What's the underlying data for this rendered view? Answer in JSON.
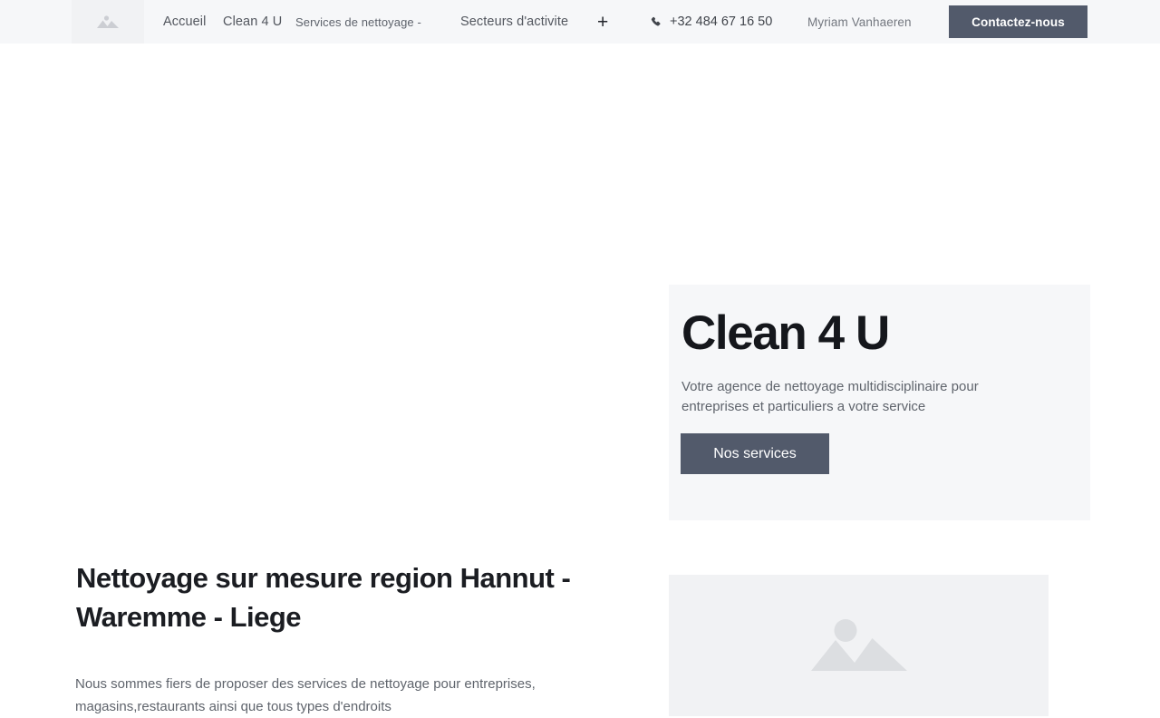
{
  "navbar": {
    "logo_icon": "image-placeholder-icon",
    "links": [
      {
        "label": "Accueil"
      },
      {
        "label": "Clean 4 U"
      },
      {
        "label": "Services de nettoyage -"
      },
      {
        "label": "Secteurs d'activite"
      }
    ],
    "plus_icon_label": "+",
    "phone_icon": "phone-icon",
    "phone": "+32 484 67 16 50",
    "user": "Myriam Vanhaeren",
    "contact_button": "Contactez-nous"
  },
  "hero": {
    "title": "Clean 4 U",
    "subtitle": "Votre agence de nettoyage multidisciplinaire pour entreprises et particuliers a votre service",
    "cta": "Nos services"
  },
  "content": {
    "heading": "Nettoyage sur mesure region Hannut - Waremme - Liege",
    "paragraph": "Nous sommes fiers de proposer des services de nettoyage pour entreprises, magasins,restaurants ainsi que tous types d'endroits",
    "image_icon": "image-placeholder-icon"
  },
  "colors": {
    "accent": "#525a6b",
    "nav_background": "#f6f7f9",
    "card_background": "#f6f7f9",
    "placeholder_background": "#f1f2f4",
    "placeholder_icon": "#dcdee1",
    "text_dark": "#1b1d22",
    "text_muted": "#5f646c"
  }
}
